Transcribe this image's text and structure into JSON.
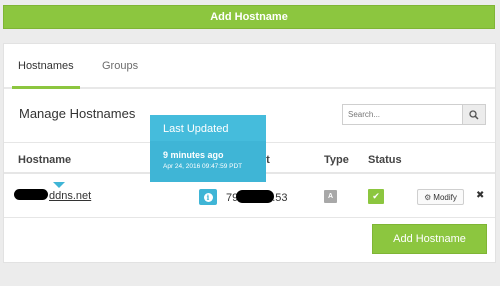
{
  "top_button": {
    "label": "Add Hostname"
  },
  "tabs": [
    {
      "label": "Hostnames",
      "active": true
    },
    {
      "label": "Groups",
      "active": false
    }
  ],
  "manage": {
    "title": "Manage Hostnames"
  },
  "search": {
    "placeholder": "Search..."
  },
  "table": {
    "headers": {
      "hostname": "Hostname",
      "ip": "et",
      "type": "Type",
      "status": "Status"
    },
    "rows": [
      {
        "hostname": "ddns.net",
        "ip_suffix": ".53",
        "ip_prefix": "79",
        "type": "A",
        "modify_label": "Modify"
      }
    ]
  },
  "tooltip": {
    "title": "Last Updated",
    "relative": "9 minutes ago",
    "absolute": "Apr 24, 2016 09:47:59 PDT"
  },
  "add_button": {
    "label": "Add Hostname"
  },
  "colors": {
    "accent_green": "#8cc63f",
    "info_blue": "#3fb5d6"
  },
  "icons": {
    "search": "search-icon",
    "info": "info-icon",
    "status": "check-icon",
    "modify": "gear-icon",
    "delete": "close-icon"
  }
}
